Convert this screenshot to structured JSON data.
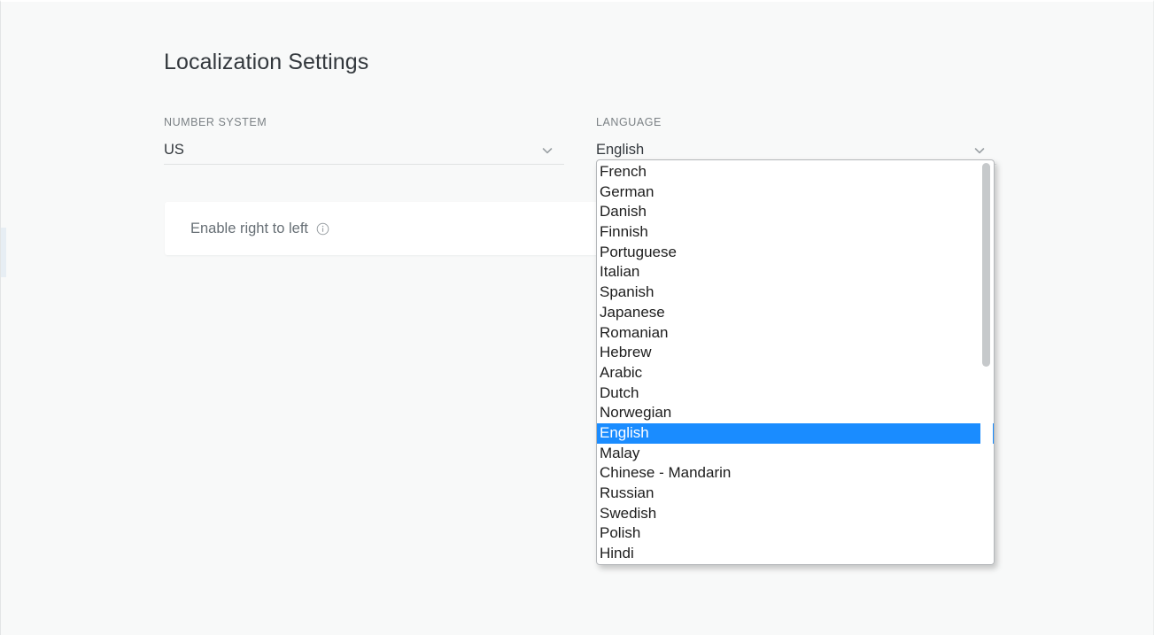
{
  "page": {
    "title": "Localization Settings",
    "background_color": "#f8f9f9",
    "accent_color": "#1a8cff"
  },
  "fields": {
    "number_system": {
      "label": "NUMBER SYSTEM",
      "value": "US",
      "icon": "chevron-down-icon"
    },
    "language": {
      "label": "LANGUAGE",
      "value": "English",
      "icon": "chevron-down-icon"
    }
  },
  "rtl_row": {
    "label": "Enable right to left",
    "icon": "info-circle-icon"
  },
  "language_dropdown": {
    "open": true,
    "selected": "English",
    "options": [
      "French",
      "German",
      "Danish",
      "Finnish",
      "Portuguese",
      "Italian",
      "Spanish",
      "Japanese",
      "Romanian",
      "Hebrew",
      "Arabic",
      "Dutch",
      "Norwegian",
      "English",
      "Malay",
      "Chinese - Mandarin",
      "Russian",
      "Swedish",
      "Polish",
      "Hindi"
    ]
  }
}
